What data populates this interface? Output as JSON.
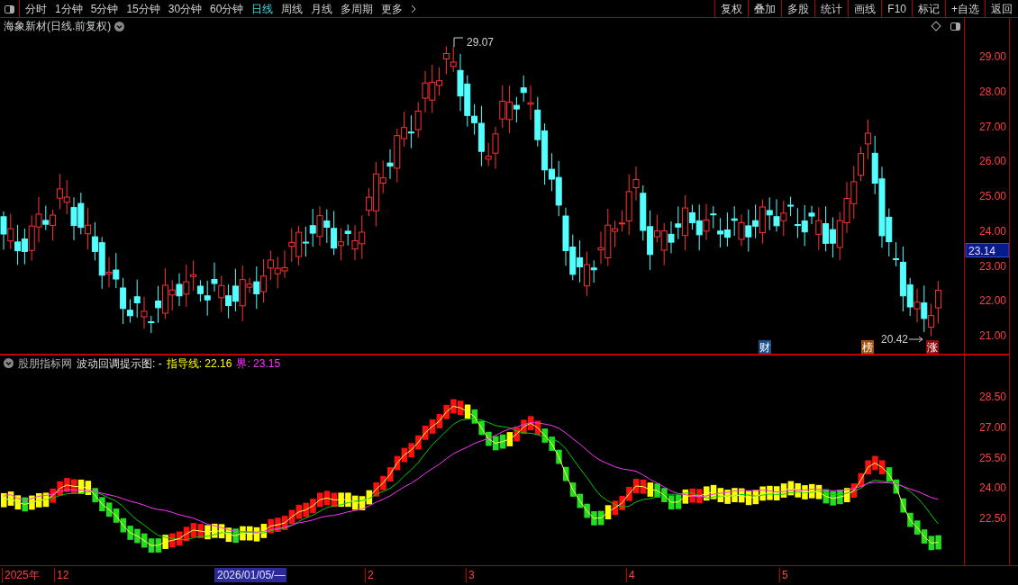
{
  "toolbar": {
    "periods": [
      {
        "label": "分时",
        "selected": false
      },
      {
        "label": "1分钟",
        "selected": false
      },
      {
        "label": "5分钟",
        "selected": false
      },
      {
        "label": "15分钟",
        "selected": false
      },
      {
        "label": "30分钟",
        "selected": false
      },
      {
        "label": "60分钟",
        "selected": false
      },
      {
        "label": "日线",
        "selected": true
      },
      {
        "label": "周线",
        "selected": false
      },
      {
        "label": "月线",
        "selected": false
      },
      {
        "label": "多周期",
        "selected": false
      },
      {
        "label": "更多",
        "selected": false
      }
    ],
    "buttons": [
      "复权",
      "叠加",
      "多股",
      "统计",
      "画线",
      "F10",
      "标记",
      "+自选",
      "返回"
    ]
  },
  "main_chart": {
    "title": "海象新材(日线.前复权)",
    "high_label": "29.07",
    "low_label": "20.42",
    "current_price": "23.14",
    "yticks": [
      "29.00",
      "28.00",
      "27.00",
      "26.00",
      "25.00",
      "24.00",
      "23.00",
      "22.00",
      "21.00"
    ],
    "markers": [
      {
        "label": "财",
        "color": "#1c4f8c"
      },
      {
        "label": "榜",
        "color": "#a0520f"
      },
      {
        "label": "涨",
        "color": "#8c1010"
      }
    ]
  },
  "indicator": {
    "source": "股朋指标网",
    "title": "波动回调提示图: -",
    "guide": "指导线: 22.16",
    "bound": "界: 23.15",
    "yticks": [
      "28.50",
      "27.00",
      "25.50",
      "24.00",
      "22.50"
    ]
  },
  "time_axis": [
    {
      "label": "2025年",
      "selected": false
    },
    {
      "label": "12",
      "selected": false
    },
    {
      "label": "2026/01/05/—",
      "selected": true
    },
    {
      "label": "2",
      "selected": false
    },
    {
      "label": "3",
      "selected": false
    },
    {
      "label": "4",
      "selected": false
    },
    {
      "label": "5",
      "selected": false
    }
  ]
}
